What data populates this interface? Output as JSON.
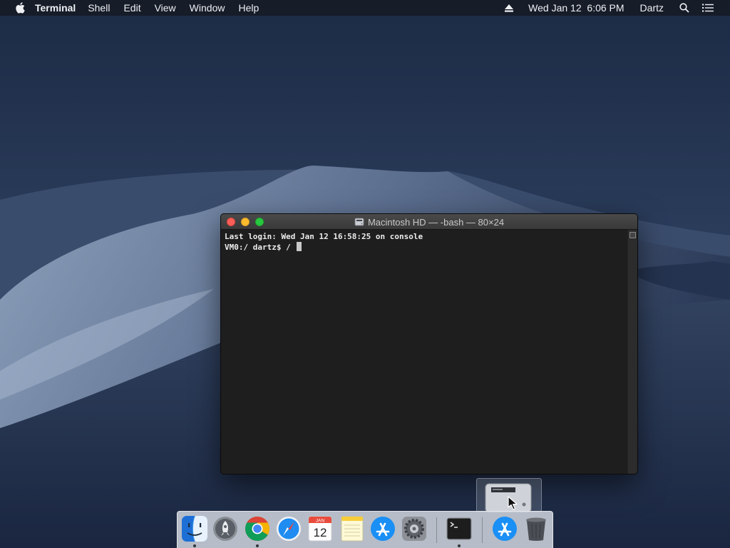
{
  "menubar": {
    "app_name": "Terminal",
    "menus": [
      "Shell",
      "Edit",
      "View",
      "Window",
      "Help"
    ],
    "clock": "Wed Jan 12  6:06 PM",
    "user": "Dartz"
  },
  "terminal": {
    "title": "Macintosh HD — -bash — 80×24",
    "lines": [
      "Last login: Wed Jan 12 16:58:25 on console",
      "VM0:/ dartz$ / "
    ]
  },
  "dock": {
    "items": [
      {
        "name": "finder-icon",
        "running": true
      },
      {
        "name": "launchpad-icon",
        "running": false
      },
      {
        "name": "chrome-icon",
        "running": true
      },
      {
        "name": "safari-icon",
        "running": false
      },
      {
        "name": "calendar-icon",
        "running": false
      },
      {
        "name": "notes-icon",
        "running": false
      },
      {
        "name": "app-store-icon",
        "running": false
      },
      {
        "name": "system-preferences-icon",
        "running": false
      },
      {
        "name": "terminal-icon",
        "running": true
      },
      {
        "name": "app-store-download-icon",
        "running": false
      },
      {
        "name": "trash-icon",
        "running": false
      }
    ],
    "calendar": {
      "month": "JAN",
      "day": "12"
    }
  },
  "colors": {
    "accent_close": "#fc5f57",
    "accent_minimize": "#fdbb2e",
    "accent_zoom": "#28c840",
    "terminal_bg": "#1e1e1e"
  }
}
